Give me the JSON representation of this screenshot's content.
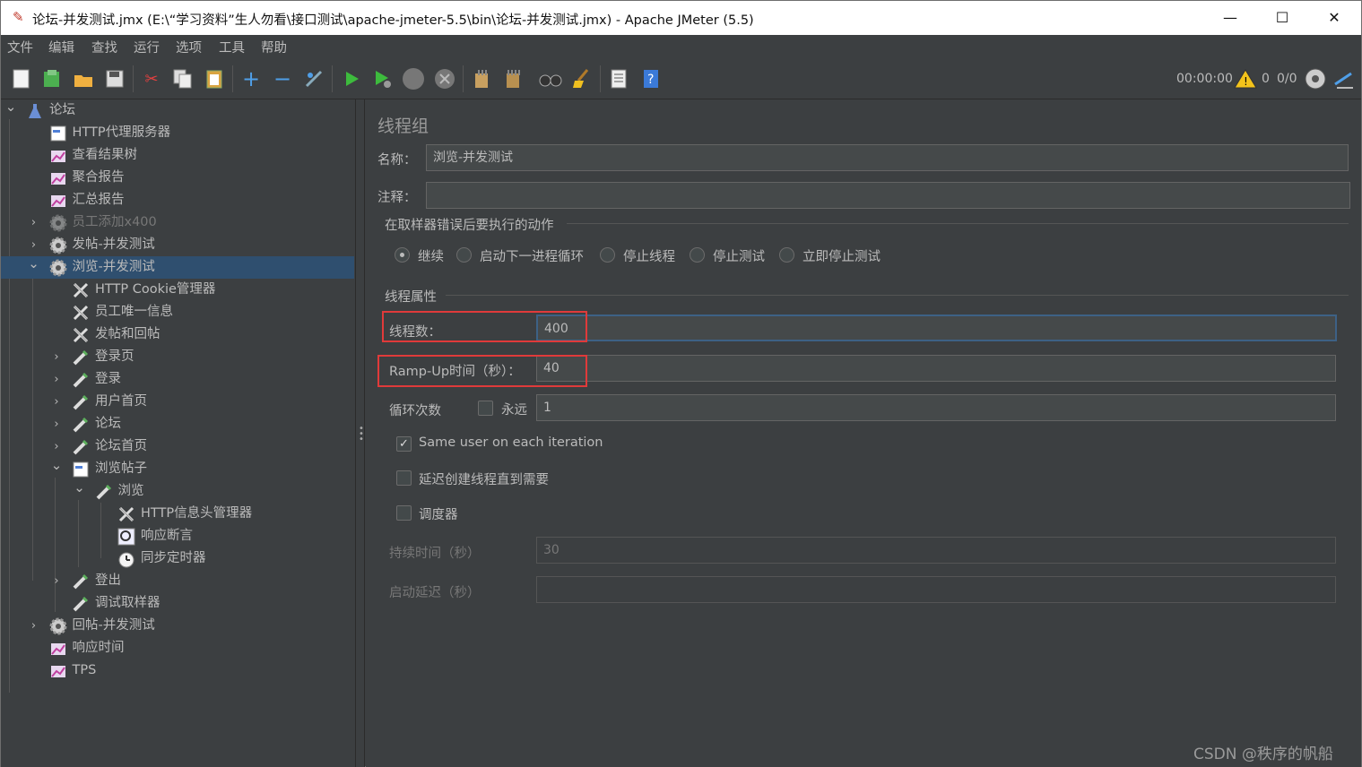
{
  "window": {
    "title": "论坛-并发测试.jmx (E:\\“学习资料”生人勿看\\接口测试\\apache-jmeter-5.5\\bin\\论坛-并发测试.jmx) - Apache JMeter (5.5)",
    "minimize": "—",
    "maximize": "☐",
    "close": "✕"
  },
  "menu": [
    "文件",
    "编辑",
    "查找",
    "运行",
    "选项",
    "工具",
    "帮助"
  ],
  "toolbar": {
    "timer": "00:00:00",
    "warn_count": "0",
    "threads": "0/0"
  },
  "tree": [
    {
      "label": "论坛",
      "icon": "test-plan-icon"
    },
    {
      "label": "HTTP代理服务器",
      "icon": "proxy-icon"
    },
    {
      "label": "查看结果树",
      "icon": "listener-icon"
    },
    {
      "label": "聚合报告",
      "icon": "listener-icon"
    },
    {
      "label": "汇总报告",
      "icon": "listener-icon"
    },
    {
      "label": "员工添加x400",
      "icon": "thread-group-icon",
      "disabled": true
    },
    {
      "label": "发帖-并发测试",
      "icon": "thread-group-icon"
    },
    {
      "label": "浏览-并发测试",
      "icon": "thread-group-icon",
      "selected": true
    },
    {
      "label": "HTTP Cookie管理器",
      "icon": "config-icon"
    },
    {
      "label": "员工唯一信息",
      "icon": "config-icon"
    },
    {
      "label": "发帖和回帖",
      "icon": "config-icon"
    },
    {
      "label": "登录页",
      "icon": "sampler-icon"
    },
    {
      "label": "登录",
      "icon": "sampler-icon"
    },
    {
      "label": "用户首页",
      "icon": "sampler-icon"
    },
    {
      "label": "论坛",
      "icon": "sampler-icon"
    },
    {
      "label": "论坛首页",
      "icon": "sampler-icon"
    },
    {
      "label": "浏览帖子",
      "icon": "controller-icon"
    },
    {
      "label": "浏览",
      "icon": "sampler-icon"
    },
    {
      "label": "HTTP信息头管理器",
      "icon": "config-icon"
    },
    {
      "label": "响应断言",
      "icon": "assertion-icon"
    },
    {
      "label": "同步定时器",
      "icon": "timer-icon"
    },
    {
      "label": "登出",
      "icon": "sampler-icon"
    },
    {
      "label": "调试取样器",
      "icon": "sampler-icon"
    },
    {
      "label": "回帖-并发测试",
      "icon": "thread-group-icon"
    },
    {
      "label": "响应时间",
      "icon": "listener-icon"
    },
    {
      "label": "TPS",
      "icon": "listener-icon"
    }
  ],
  "panel": {
    "title": "线程组",
    "name_label": "名称：",
    "name_value": "浏览-并发测试",
    "comment_label": "注释：",
    "comment_value": "",
    "on_error_section": "在取样器错误后要执行的动作",
    "on_error_options": [
      "继续",
      "启动下一进程循环",
      "停止线程",
      "停止测试",
      "立即停止测试"
    ],
    "on_error_selected": "继续",
    "thread_props_section": "线程属性",
    "threads_label": "线程数：",
    "threads_value": "400",
    "rampup_label": "Ramp-Up时间（秒）：",
    "rampup_value": "40",
    "loop_label": "循环次数",
    "forever_label": "永远",
    "forever_checked": false,
    "loop_value": "1",
    "same_user_label": "Same user on each iteration",
    "same_user_checked": true,
    "delay_label": "延迟创建线程直到需要",
    "delay_checked": false,
    "scheduler_label": "调度器",
    "scheduler_checked": false,
    "duration_label": "持续时间（秒）",
    "duration_value": "30",
    "startup_delay_label": "启动延迟（秒）",
    "startup_delay_value": ""
  },
  "watermark": "CSDN @秩序的帆船"
}
